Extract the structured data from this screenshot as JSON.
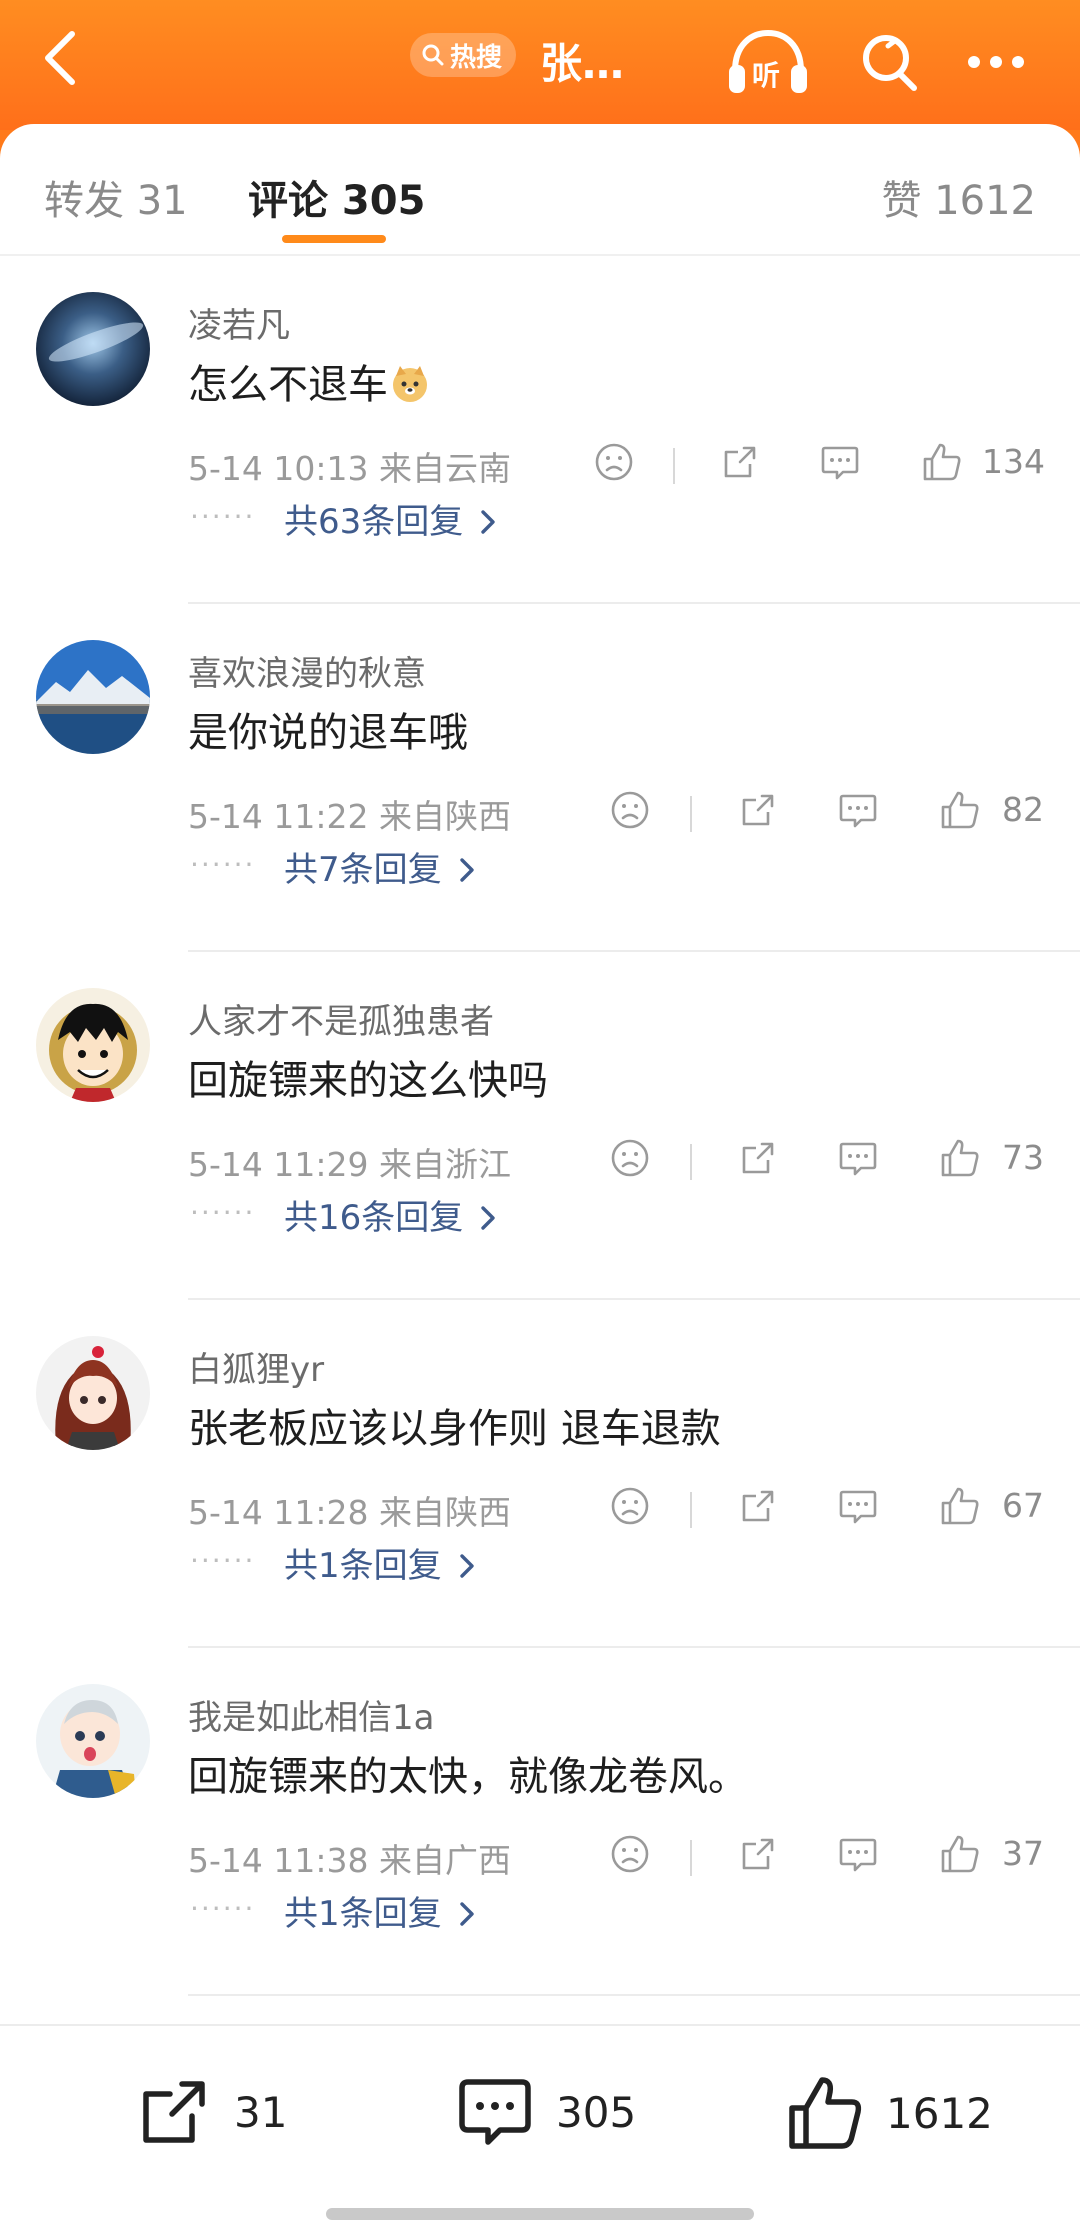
{
  "header": {
    "hot_label": "热搜",
    "title": "张…",
    "listen_label": "听"
  },
  "tabs": {
    "repost": "转发 31",
    "comments": "评论 305",
    "likes": "赞 1612"
  },
  "comments": [
    {
      "username": "凌若凡",
      "content": "怎么不退车",
      "meta": "5-14 10:13  来自云南",
      "likes": "134",
      "replies": "共63条回复",
      "avatar": "galaxy"
    },
    {
      "username": "喜欢浪漫的秋意",
      "content": "是你说的退车哦",
      "meta": "5-14 11:22  来自陕西",
      "likes": "82",
      "replies": "共7条回复",
      "avatar": "mountain"
    },
    {
      "username": "人家才不是孤独患者",
      "content": "回旋镖来的这么快吗",
      "meta": "5-14 11:29  来自浙江",
      "likes": "73",
      "replies": "共16条回复",
      "avatar": "cartoon-boy"
    },
    {
      "username": "白狐狸yr",
      "content": "张老板应该以身作则 退车退款",
      "meta": "5-14 11:28  来自陕西",
      "likes": "67",
      "replies": "共1条回复",
      "avatar": "anime-girl"
    },
    {
      "username": "我是如此相信1a",
      "content": "回旋镖来的太快，就像龙卷风。",
      "meta": "5-14 11:38  来自广西",
      "likes": "37",
      "replies": "共1条回复",
      "avatar": "cartoon-baby"
    }
  ],
  "bottom_bar": {
    "reposts": "31",
    "comments": "305",
    "likes": "1612"
  },
  "icons": {
    "back": "chevron-left-icon",
    "listen": "headphones-icon",
    "search": "search-icon",
    "more": "more-icon",
    "dislike": "sad-face-icon",
    "share": "share-icon",
    "reply": "comment-icon",
    "like": "thumbs-up-icon"
  },
  "colors": {
    "brand_orange": "#ff7a1a",
    "tab_accent": "#ff8a1a",
    "reply_link": "#3f5b8c"
  }
}
